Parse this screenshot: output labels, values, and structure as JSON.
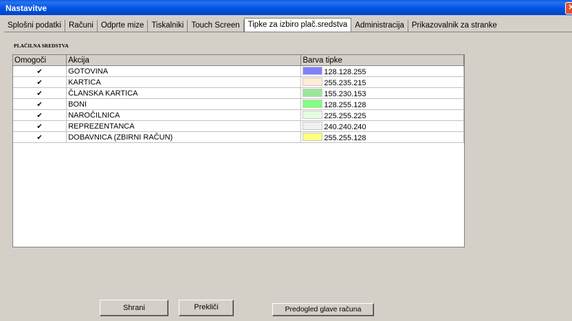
{
  "window": {
    "title": "Nastavitve",
    "close_symbol": "✕"
  },
  "tabs": [
    {
      "label": "Splošni podatki",
      "active": false
    },
    {
      "label": "Računi",
      "active": false
    },
    {
      "label": "Odprte mize",
      "active": false
    },
    {
      "label": "Tiskalniki",
      "active": false
    },
    {
      "label": "Touch Screen",
      "active": false
    },
    {
      "label": "Tipke za izbiro plač.sredstva",
      "active": true
    },
    {
      "label": "Administracija",
      "active": false
    },
    {
      "label": "Prikazovalnik za stranke",
      "active": false
    }
  ],
  "section": {
    "label": "PLAČILNA SREDSTVA"
  },
  "grid": {
    "headers": {
      "enabled": "Omogoči",
      "action": "Akcija",
      "color": "Barva tipke"
    },
    "check_symbol": "✔",
    "rows": [
      {
        "enabled": true,
        "action": "GOTOVINA",
        "color_rgb": "128.128.255",
        "color_hex": "#8080ff"
      },
      {
        "enabled": true,
        "action": "KARTICA",
        "color_rgb": "255.235.215",
        "color_hex": "#ffebd7"
      },
      {
        "enabled": true,
        "action": "ČLANSKA KARTICA",
        "color_rgb": "155.230.153",
        "color_hex": "#9be699"
      },
      {
        "enabled": true,
        "action": "BONI",
        "color_rgb": "128.255.128",
        "color_hex": "#80ff80"
      },
      {
        "enabled": true,
        "action": "NAROČILNICA",
        "color_rgb": "225.255.225",
        "color_hex": "#e1ffe1"
      },
      {
        "enabled": true,
        "action": "REPREZENTANCA",
        "color_rgb": "240.240.240",
        "color_hex": "#f0f0f0"
      },
      {
        "enabled": true,
        "action": "DOBAVNICA (ZBIRNI RAČUN)",
        "color_rgb": "255.255.128",
        "color_hex": "#ffff80"
      }
    ]
  },
  "buttons": {
    "save": "Shrani",
    "cancel": "Prekliči",
    "preview": "Predogled glave računa"
  }
}
